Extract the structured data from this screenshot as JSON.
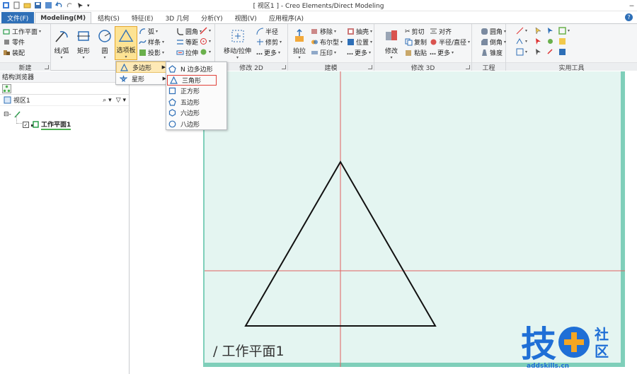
{
  "window": {
    "title": "[ 视区1 ] - Creo Elements/Direct Modeling"
  },
  "tabs": [
    {
      "label": "文件(F)"
    },
    {
      "label": "Modeling(M)"
    },
    {
      "label": "结构(S)"
    },
    {
      "label": "特征(E)"
    },
    {
      "label": "3D 几何"
    },
    {
      "label": "分析(Y)"
    },
    {
      "label": "视图(V)"
    },
    {
      "label": "应用程序(A)"
    }
  ],
  "ribbon": {
    "new_group": {
      "label": "新建",
      "items": [
        "工作平面",
        "零件",
        "装配"
      ]
    },
    "create2d": {
      "line_arc": "线/弧",
      "rect": "矩形",
      "circle": "圆",
      "option_board": "选项板",
      "arc": "弧",
      "spline": "样条",
      "projection": "投影",
      "fillet": "圆角",
      "equidistant": "等距",
      "stretch": "拉伸"
    },
    "modify2d": {
      "label": "修改 2D",
      "move_stretch": "移动/拉伸",
      "radius": "半径",
      "trim": "修剪",
      "more": "更多"
    },
    "modeling": {
      "label": "建模",
      "pull": "拍拉",
      "move": "移除",
      "boolean": "布尔型",
      "press": "压印",
      "shell": "抽壳",
      "position": "位置",
      "more": "更多"
    },
    "modify3d": {
      "label": "修改 3D",
      "modify": "修改",
      "cut": "剪切",
      "copy": "复制",
      "paste": "粘贴",
      "align": "对齐",
      "radius_diameter": "半径/直径",
      "more": "更多"
    },
    "engineering": {
      "label": "工程",
      "fillet": "圆角",
      "chamfer": "倒角",
      "taper": "锥度"
    },
    "utilities": {
      "label": "实用工具"
    }
  },
  "left_panel": {
    "title": "结构浏览器",
    "viewport": "视区1",
    "workplane_node": "工作平面1"
  },
  "menu1": {
    "items": [
      {
        "label": "多边形",
        "selected": true
      },
      {
        "label": "星形",
        "selected": false
      }
    ]
  },
  "menu2": {
    "items": [
      {
        "label": "N 边多边形",
        "icon": "pentagon-icon"
      },
      {
        "label": "三角形",
        "icon": "triangle-icon",
        "highlighted": true
      },
      {
        "label": "正方形",
        "icon": "square-icon"
      },
      {
        "label": "五边形",
        "icon": "pentagon-icon"
      },
      {
        "label": "六边形",
        "icon": "hexagon-icon"
      },
      {
        "label": "八边形",
        "icon": "circle-icon"
      }
    ]
  },
  "canvas": {
    "workplane_label": "/ 工作平面1"
  },
  "watermark": {
    "char1": "技",
    "char2": "社",
    "char3": "区",
    "url": "addskills.cn"
  },
  "colors": {
    "workplane_fill": "#e4f5f1",
    "workplane_border": "#7fcfba",
    "axis": "#e06060",
    "accent": "#2e6fb7"
  }
}
